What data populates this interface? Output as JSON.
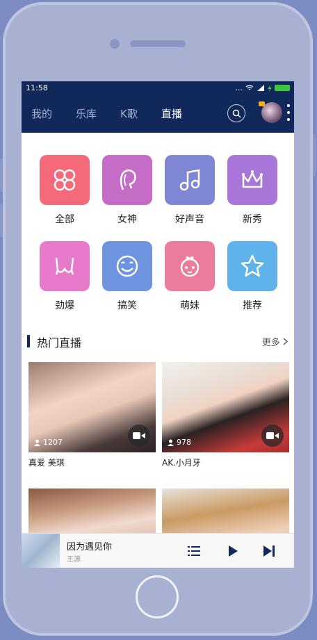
{
  "status": {
    "time": "11:58",
    "signal": "...",
    "battery_color": "#3ec83e"
  },
  "nav": {
    "tabs": [
      {
        "label": "我的",
        "active": false
      },
      {
        "label": "乐库",
        "active": false
      },
      {
        "label": "K歌",
        "active": false
      },
      {
        "label": "直播",
        "active": true
      }
    ],
    "search_icon": "search-icon",
    "avatar_icon": "avatar",
    "more_icon": "more-vertical-icon"
  },
  "categories": [
    {
      "label": "全部",
      "icon": "grid-circles-icon",
      "color": "#f46a7b"
    },
    {
      "label": "女神",
      "icon": "goddess-face-icon",
      "color": "#c56dc6"
    },
    {
      "label": "好声音",
      "icon": "music-note-icon",
      "color": "#7f86d4"
    },
    {
      "label": "新秀",
      "icon": "crown-icon",
      "color": "#a876d8"
    },
    {
      "label": "劲爆",
      "icon": "bikini-icon",
      "color": "#e77acb"
    },
    {
      "label": "搞笑",
      "icon": "smiley-icon",
      "color": "#6f94df"
    },
    {
      "label": "萌妹",
      "icon": "cute-girl-icon",
      "color": "#ec7c9b"
    },
    {
      "label": "推荐",
      "icon": "star-icon",
      "color": "#5fb3ea"
    }
  ],
  "hot": {
    "title": "热门直播",
    "more": "更多",
    "cards": [
      {
        "name": "真爱 美琪",
        "viewers": "1207"
      },
      {
        "name": "AK.小月牙",
        "viewers": "978"
      },
      {
        "name": "",
        "viewers": ""
      },
      {
        "name": "",
        "viewers": ""
      }
    ]
  },
  "player": {
    "title": "因为遇见你",
    "artist": "王源"
  },
  "colors": {
    "navbar": "#10285a",
    "frame": "#a9b1d3",
    "background": "#7d8bc3"
  }
}
